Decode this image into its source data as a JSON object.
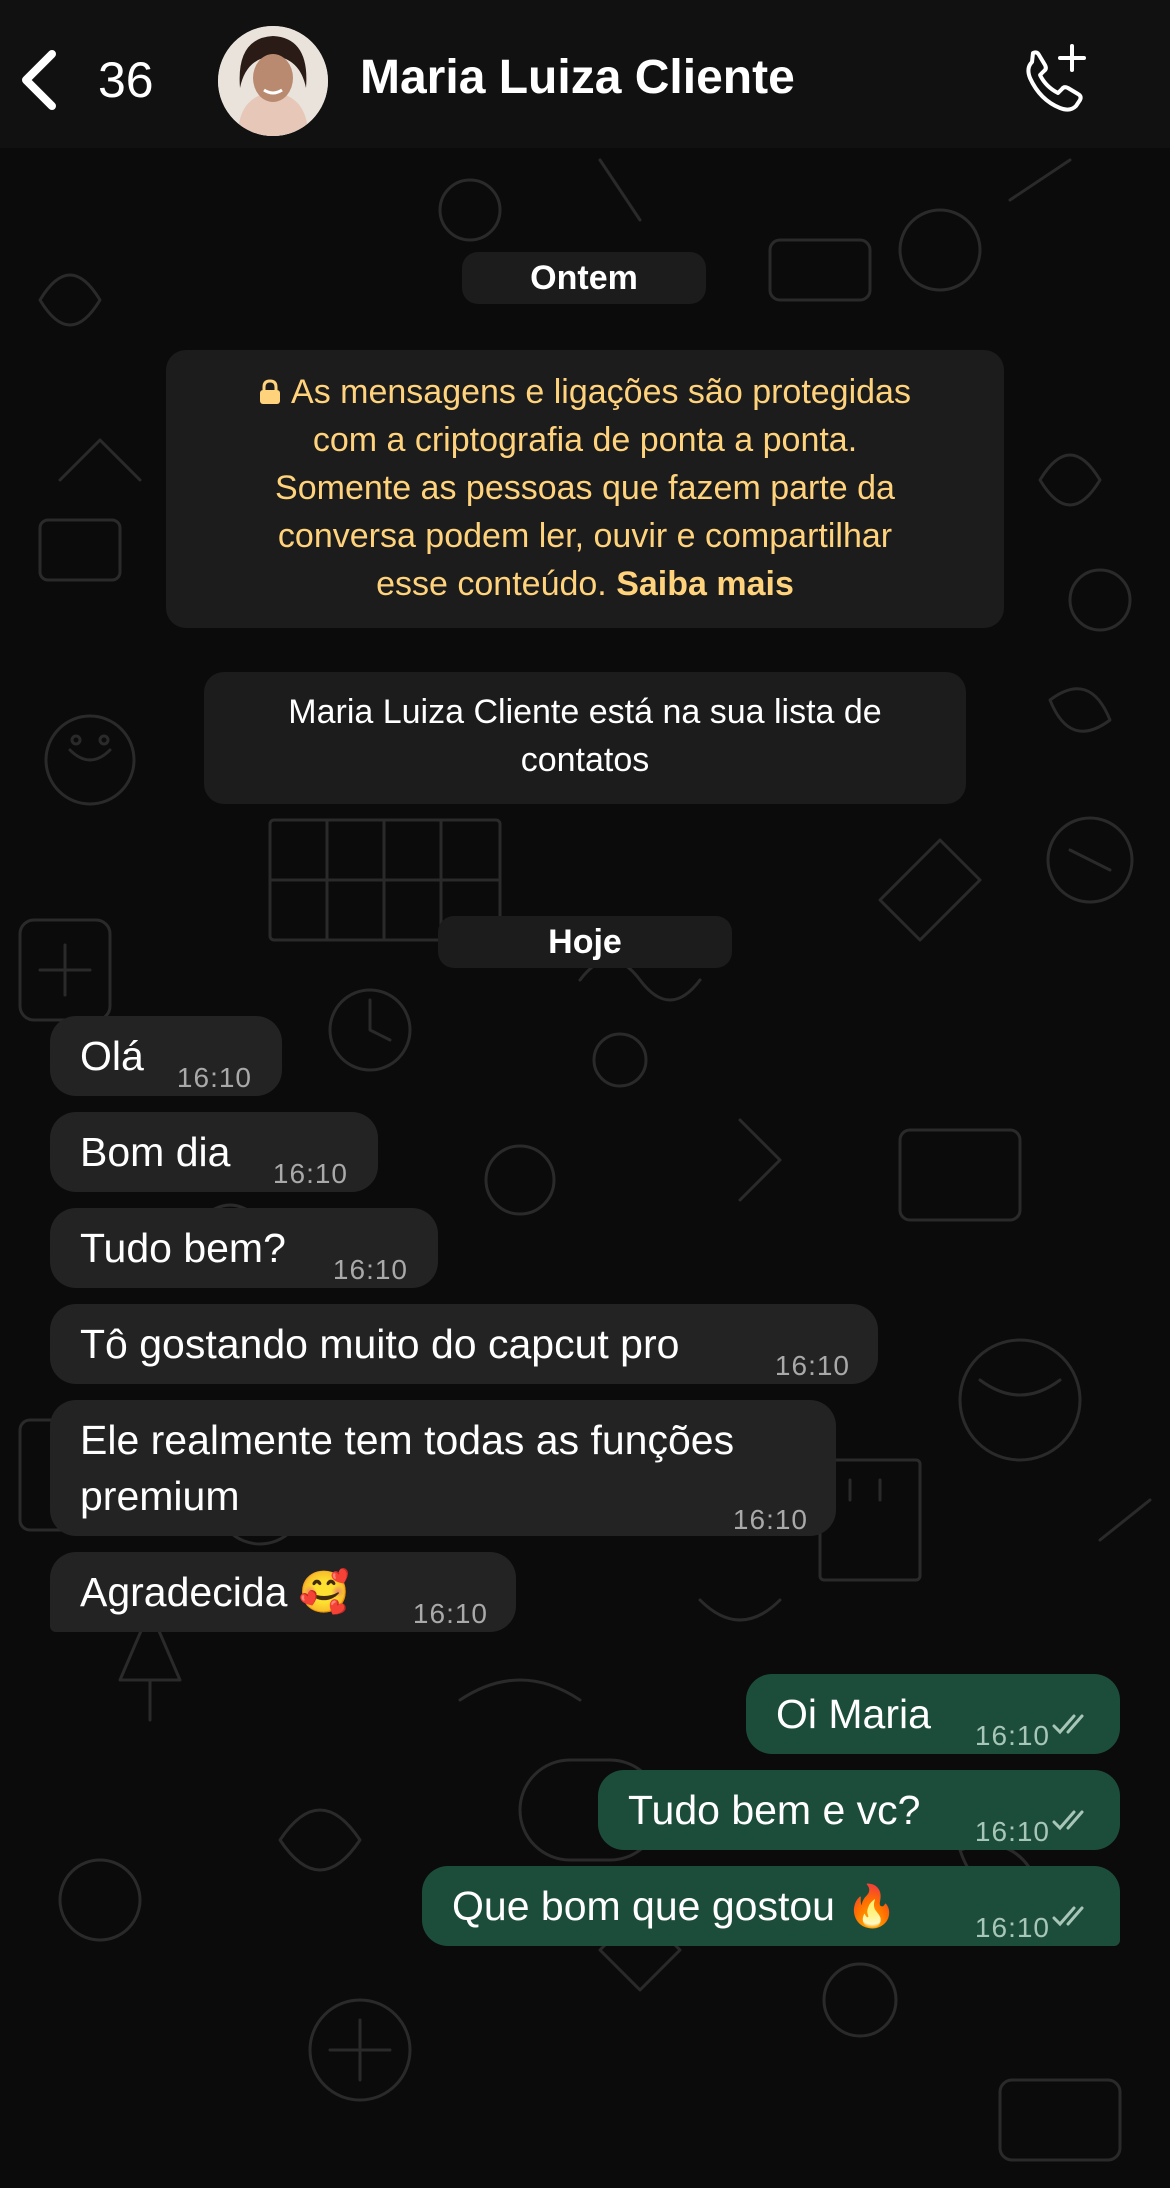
{
  "header": {
    "back_count": "36",
    "contact_name": "Maria Luiza Cliente",
    "icons": [
      "chevron-left-icon",
      "add-call-icon"
    ]
  },
  "date_chips": {
    "yesterday": "Ontem",
    "today": "Hoje"
  },
  "encryption_notice": {
    "line1": "As mensagens e ligações são protegidas",
    "line2": "com a criptografia de ponta a ponta.",
    "line3": "Somente as pessoas que fazem parte da",
    "line4": "conversa podem ler, ouvir e compartilhar",
    "line5": "esse conteúdo.",
    "learn_more": "Saiba mais",
    "color": "#ffd27c"
  },
  "contact_info": {
    "line1": "Maria Luiza Cliente está na sua lista de",
    "line2": "contatos"
  },
  "messages_in": [
    {
      "text": "Olá",
      "time": "16:10"
    },
    {
      "text": "Bom dia",
      "time": "16:10"
    },
    {
      "text": "Tudo bem?",
      "time": "16:10"
    },
    {
      "text": "Tô gostando muito do capcut pro",
      "time": "16:10"
    },
    {
      "line1": "Ele realmente tem todas as funções",
      "line2": "premium",
      "time": "16:10"
    },
    {
      "text": "Agradecida 🥰",
      "time": "16:10"
    }
  ],
  "messages_out": [
    {
      "text": "Oi Maria",
      "time": "16:10",
      "status": "read-ticks-icon"
    },
    {
      "text": "Tudo bem e vc?",
      "time": "16:10",
      "status": "read-ticks-icon"
    },
    {
      "text": "Que bom que gostou 🔥",
      "time": "16:10",
      "status": "read-ticks-icon"
    }
  ],
  "colors": {
    "background": "#0b0b0b",
    "incoming_bubble": "#232323",
    "outgoing_bubble": "#1c4d3b",
    "chip": "#1c1c1c"
  }
}
